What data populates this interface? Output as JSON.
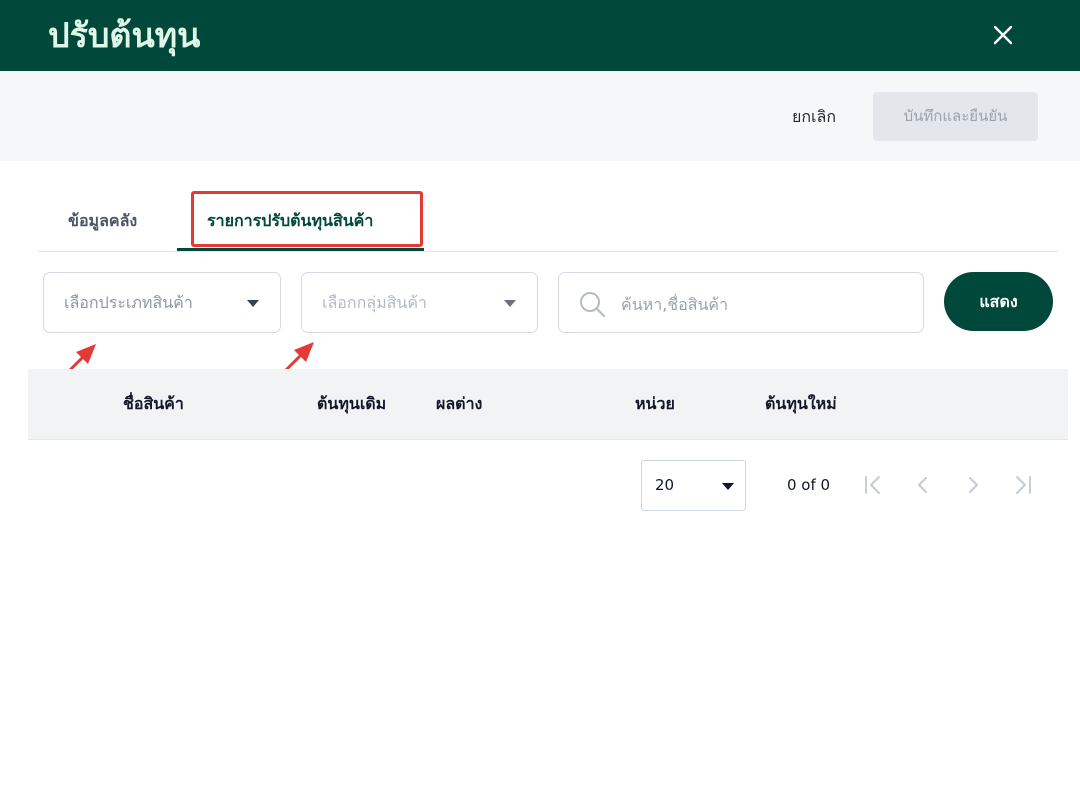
{
  "modal": {
    "title": "ปรับต้นทุน",
    "close_icon": "close-icon"
  },
  "actions": {
    "cancel_label": "ยกเลิก",
    "save_label": "บันทึกและยืนยัน"
  },
  "tabs": [
    {
      "label": "ข้อมูลคลัง",
      "active": false
    },
    {
      "label": "รายการปรับต้นทุนสินค้า",
      "active": true
    }
  ],
  "filters": {
    "product_type_placeholder": "เลือกประเภทสินค้า",
    "product_group_placeholder": "เลือกกลุ่มสินค้า",
    "search_placeholder": "ค้นหา,ชื่อสินค้า",
    "search_value": "",
    "show_label": "แสดง"
  },
  "table": {
    "columns": [
      "ชื่อสินค้า",
      "ต้นทุนเดิม",
      "ผลต่าง",
      "หน่วย",
      "ต้นทุนใหม่"
    ],
    "rows": []
  },
  "pagination": {
    "page_size": "20",
    "range_text": "0 of 0"
  },
  "colors": {
    "brand": "#00483a",
    "highlight": "#e53935",
    "annotation_arrow": "#e53935"
  }
}
